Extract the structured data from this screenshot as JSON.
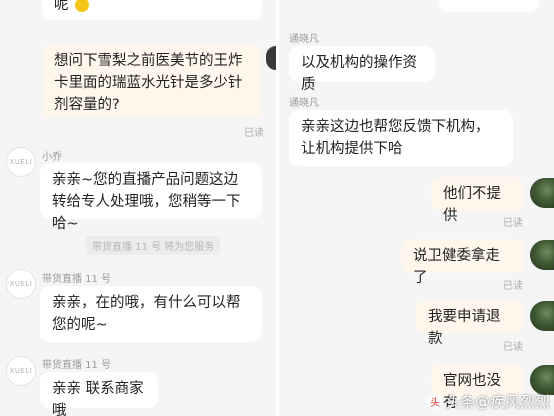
{
  "left": {
    "top_fragment": "呢",
    "question": "想问下雪梨之前医美节的王炸卡里面的瑞蓝水光针是多少针剂容量的?",
    "question_status": "已读",
    "messages": [
      {
        "sender": "小乔",
        "avatar_text": "XUELI",
        "text": "亲亲~您的直播产品问题这边转给专人处理哦，您稍等一下哈~"
      },
      {
        "sender": "带货直播 11 号",
        "avatar_text": "XUELI",
        "text": "亲亲，在的哦，有什么可以帮您的呢~"
      },
      {
        "sender": "带货直播 11 号",
        "avatar_text": "XUELI",
        "text": "亲亲 联系商家哦"
      }
    ],
    "system_notice": "带货直播 11 号 将为您服务"
  },
  "right": {
    "messages": [
      {
        "sender": "通晓凡",
        "text": "以及机构的操作资质"
      },
      {
        "sender": "通晓凡",
        "text": "亲亲这边也帮您反馈下机构，让机构提供下哈"
      }
    ],
    "user_messages": [
      {
        "text": "他们不提供",
        "status": "已读"
      },
      {
        "text": "说卫健委拿走了",
        "status": "已读"
      },
      {
        "text": "我要申请退款",
        "status": "已读"
      },
      {
        "text": "官网也没有",
        "status": ""
      }
    ]
  },
  "watermark": {
    "logo": "头",
    "text": "头条@疾风烈烈"
  }
}
